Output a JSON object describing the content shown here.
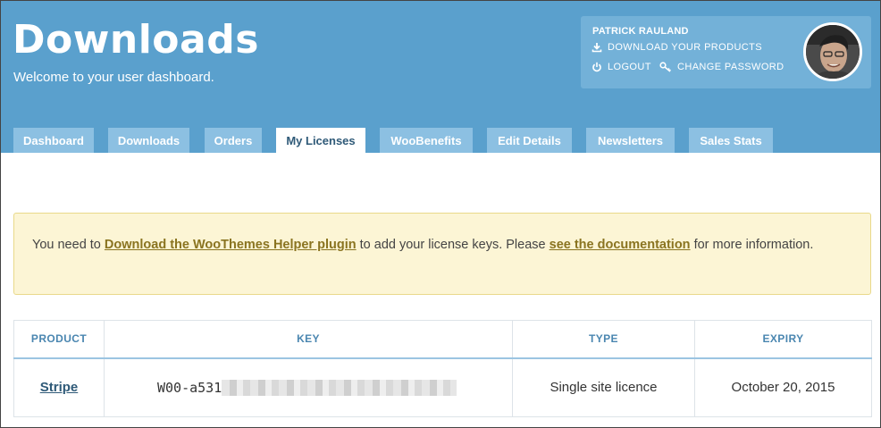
{
  "header": {
    "title": "Downloads",
    "subtitle": "Welcome to your user dashboard."
  },
  "user": {
    "name": "PATRICK RAULAND",
    "download_link": "DOWNLOAD YOUR PRODUCTS",
    "logout_link": "LOGOUT",
    "password_link": "CHANGE PASSWORD",
    "download_icon": "download-icon",
    "logout_icon": "power-icon",
    "password_icon": "key-icon"
  },
  "tabs": [
    {
      "label": "Dashboard",
      "active": false
    },
    {
      "label": "Downloads",
      "active": false
    },
    {
      "label": "Orders",
      "active": false
    },
    {
      "label": "My Licenses",
      "active": true
    },
    {
      "label": "WooBenefits",
      "active": false
    },
    {
      "label": "Edit Details",
      "active": false
    },
    {
      "label": "Newsletters",
      "active": false
    },
    {
      "label": "Sales Stats",
      "active": false
    }
  ],
  "notice": {
    "text_1": "You need to ",
    "link_1": "Download the WooThemes Helper plugin",
    "text_2": " to add your license keys. Please ",
    "link_2": "see the documentation",
    "text_3": " for more information."
  },
  "table": {
    "headers": [
      "PRODUCT",
      "KEY",
      "TYPE",
      "EXPIRY"
    ],
    "rows": [
      {
        "product": "Stripe",
        "key": "W00-a531",
        "type": "Single site licence",
        "expiry": "October 20, 2015"
      }
    ]
  },
  "colors": {
    "header_bg": "#5aa0cd",
    "tab_bg": "#8cc0e2",
    "notice_bg": "#fcf5d5",
    "link_gold": "#8a7420"
  }
}
